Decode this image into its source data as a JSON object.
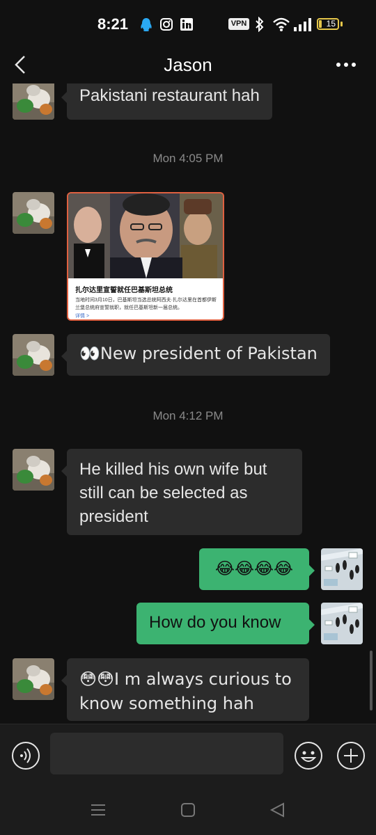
{
  "status_bar": {
    "time": "8:21",
    "icons": [
      "qq-icon",
      "instagram-icon",
      "linkedin-icon",
      "vpn-icon",
      "bluetooth-icon",
      "wifi-icon",
      "signal-icon",
      "battery-icon"
    ],
    "vpn_label": "VPN",
    "battery_level": "15",
    "battery_color": "#e6c74a"
  },
  "header": {
    "title": "Jason",
    "back_icon": "chevron-left-icon",
    "more_icon": "more-dots-icon"
  },
  "messages": [
    {
      "sender": "Jason",
      "direction": "incoming",
      "text": "Pakistani restaurant hah"
    },
    {
      "timestamp": "Mon 4:05 PM"
    },
    {
      "sender": "Jason",
      "direction": "incoming",
      "type": "news-card",
      "card_title": "扎尔达里宣誓就任巴基斯坦总统",
      "card_body": "当地时间3月10日，巴基斯坦当选总统阿西夫·扎尔达里在首都伊斯兰堡总统府宣誓就职，就任巴基斯坦新一届总统。",
      "card_more": "详情 >"
    },
    {
      "sender": "Jason",
      "direction": "incoming",
      "text": "👀New president of Pakistan"
    },
    {
      "timestamp": "Mon 4:12 PM"
    },
    {
      "sender": "Jason",
      "direction": "incoming",
      "text": "He killed his own wife but still can be selected as president"
    },
    {
      "sender": "me",
      "direction": "outgoing",
      "text": "😂😂😂😂"
    },
    {
      "sender": "me",
      "direction": "outgoing",
      "text": "How do you know"
    },
    {
      "sender": "Jason",
      "direction": "incoming",
      "text": "😳😳I m always curious to know something hah"
    }
  ],
  "input_bar": {
    "value": "",
    "voice_icon": "voice-icon",
    "emoji_icon": "emoji-icon",
    "plus_icon": "plus-icon"
  },
  "nav_bar": {
    "icons": [
      "menu-icon",
      "home-icon",
      "back-icon"
    ]
  },
  "colors": {
    "background": "#111111",
    "incoming_bubble": "#2c2c2c",
    "outgoing_bubble": "#3cb371",
    "timestamp_text": "#8a8a8a"
  }
}
